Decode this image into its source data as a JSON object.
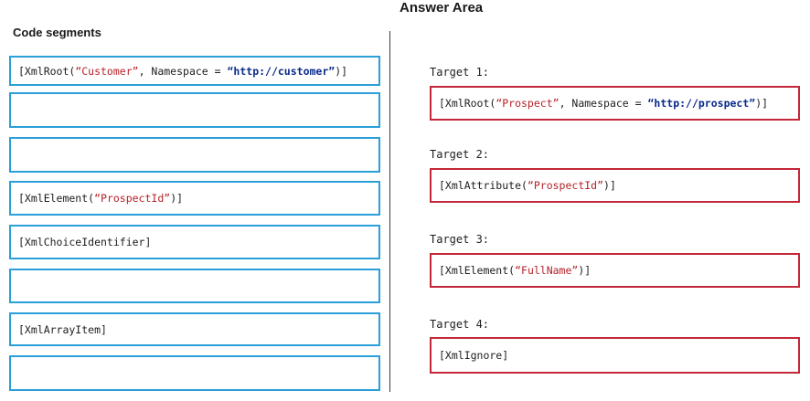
{
  "answer_area_title": "Answer Area",
  "code_segments_title": "Code segments",
  "colors": {
    "segment_border": "#2a9fd8",
    "target_border": "#c4273a",
    "string_literal": "#b5222a",
    "namespace_url": "#0a2a8a"
  },
  "segments": [
    {
      "parts": [
        "[XmlRoot(",
        "“Customer”",
        ", Namespace = ",
        "“http://customer”",
        ")]"
      ]
    },
    {
      "parts": []
    },
    {
      "parts": []
    },
    {
      "parts": [
        "[XmlElement(",
        "“ProspectId”",
        ")]"
      ]
    },
    {
      "parts": [
        "[XmlChoiceIdentifier]"
      ]
    },
    {
      "parts": []
    },
    {
      "parts": [
        "[XmlArrayItem]"
      ]
    },
    {
      "parts": []
    }
  ],
  "targets": [
    {
      "label": "Target 1:",
      "parts": [
        "[XmlRoot(",
        "“Prospect”",
        ", Namespace = ",
        "“http://prospect”",
        ")]"
      ]
    },
    {
      "label": "Target 2:",
      "parts": [
        "[XmlAttribute(",
        "“ProspectId”",
        ")]"
      ]
    },
    {
      "label": "Target 3:",
      "parts": [
        "[XmlElement(",
        "“FullName”",
        ")]"
      ]
    },
    {
      "label": "Target 4:",
      "parts": [
        "[XmlIgnore]"
      ]
    }
  ]
}
